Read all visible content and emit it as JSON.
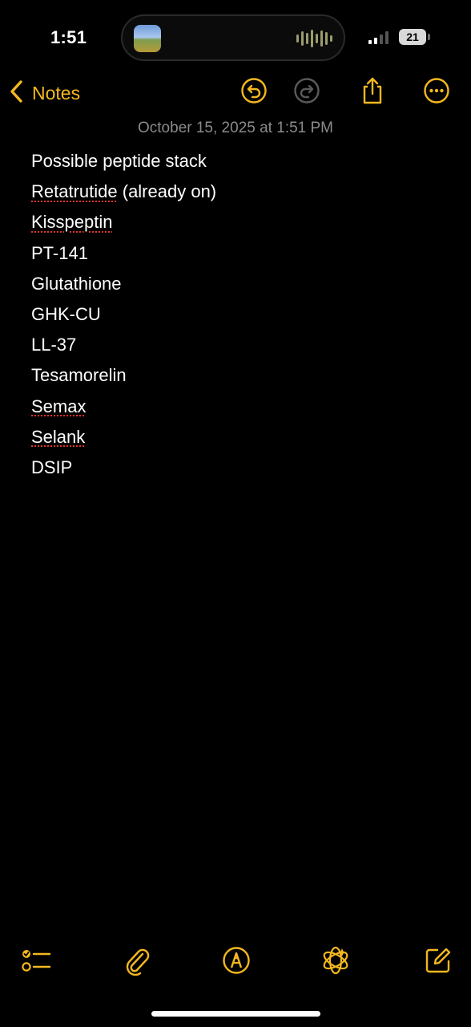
{
  "status_bar": {
    "time": "1:51",
    "battery_level": "21"
  },
  "nav": {
    "back_label": "Notes"
  },
  "note": {
    "date": "October 15, 2025 at 1:51 PM",
    "lines": [
      {
        "text": "Possible peptide stack"
      },
      {
        "misspelled": "Retatrutide",
        "rest": " (already on)"
      },
      {
        "misspelled": "Kisspeptin",
        "rest": ""
      },
      {
        "text": "PT-141"
      },
      {
        "text": "Glutathione"
      },
      {
        "text": "GHK-CU"
      },
      {
        "text": "LL-37"
      },
      {
        "text": "Tesamorelin"
      },
      {
        "misspelled": "Semax",
        "rest": ""
      },
      {
        "misspelled": "Selank",
        "rest": ""
      },
      {
        "text": "DSIP"
      }
    ]
  },
  "colors": {
    "accent": "#f4b81f",
    "background": "#000000",
    "secondary_text": "#8b8b8b",
    "spellcheck": "#e0342c"
  },
  "icons": {
    "nav": [
      "chevron-left-icon",
      "undo-icon",
      "redo-icon",
      "share-icon",
      "more-icon"
    ],
    "toolbar": [
      "checklist-icon",
      "paperclip-icon",
      "markup-icon",
      "apple-intelligence-icon",
      "compose-icon"
    ]
  }
}
